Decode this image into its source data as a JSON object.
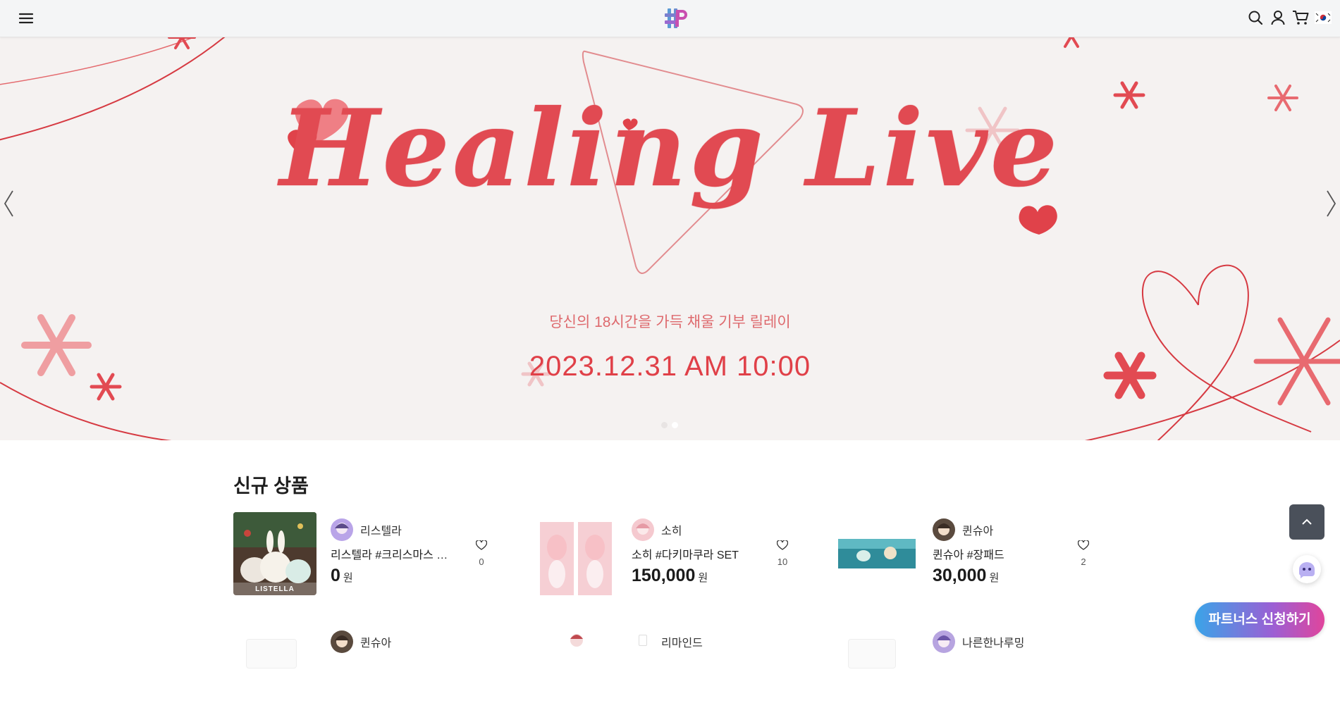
{
  "header": {
    "menu_icon": "hamburger-icon",
    "logo_alt": "logo",
    "icons": [
      "search-icon",
      "user-icon",
      "cart-icon",
      "korea-flag-icon"
    ]
  },
  "banner": {
    "headline": "Healing Live",
    "subtitle": "당신의 18시간을 가득 채울 기부 릴레이",
    "date": "2023.12.31  AM 10:00",
    "slide_count": 2,
    "active_slide": 2,
    "colors": {
      "accent": "#e14a52",
      "background": "#f5f2f1"
    }
  },
  "new_products": {
    "title": "신규 상품",
    "items": [
      {
        "seller": "리스텔라",
        "name": "리스텔라 #크리스마스 일...",
        "price": "0",
        "currency": "원",
        "likes": "0",
        "thumb_caption": "LISTELLA"
      },
      {
        "seller": "소히",
        "name": "소히 #다키마쿠라 SET",
        "price": "150,000",
        "currency": "원",
        "likes": "10"
      },
      {
        "seller": "퀸슈아",
        "name": "퀸슈아 #장패드",
        "price": "30,000",
        "currency": "원",
        "likes": "2"
      },
      {
        "seller": "퀸슈아"
      },
      {
        "seller": "리마인드"
      },
      {
        "seller": "나른한나루밍"
      }
    ]
  },
  "floating": {
    "scroll_top_icon": "chevron-up-icon",
    "chatbot_icon": "chatbot-icon",
    "partner_button": "파트너스 신청하기"
  }
}
